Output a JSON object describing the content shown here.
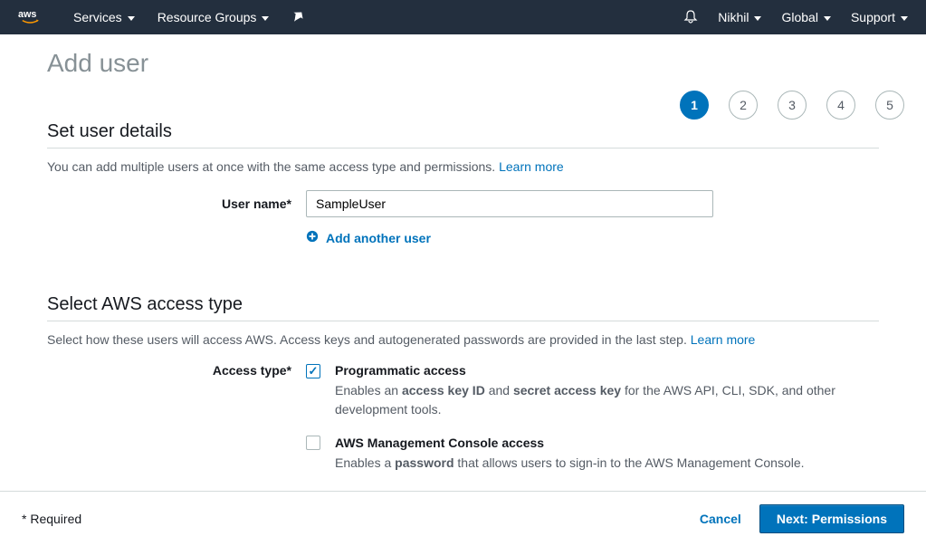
{
  "topbar": {
    "logo": "aws",
    "services": "Services",
    "resource_groups": "Resource Groups",
    "user": "Nikhil",
    "region": "Global",
    "support": "Support"
  },
  "page": {
    "title": "Add user"
  },
  "steps": {
    "s1": "1",
    "s2": "2",
    "s3": "3",
    "s4": "4",
    "s5": "5"
  },
  "section_details": {
    "title": "Set user details",
    "desc": "You can add multiple users at once with the same access type and permissions. ",
    "learn_more": "Learn more",
    "username_label": "User name*",
    "username_value": "SampleUser",
    "add_another": "Add another user"
  },
  "section_access": {
    "title": "Select AWS access type",
    "desc": "Select how these users will access AWS. Access keys and autogenerated passwords are provided in the last step. ",
    "learn_more": "Learn more",
    "access_type_label": "Access type*",
    "option1": {
      "title": "Programmatic access",
      "desc_pre": "Enables an ",
      "desc_b1": "access key ID",
      "desc_mid": " and ",
      "desc_b2": "secret access key",
      "desc_post": " for the AWS API, CLI, SDK, and other development tools."
    },
    "option2": {
      "title": "AWS Management Console access",
      "desc_pre": "Enables a ",
      "desc_b1": "password",
      "desc_post": " that allows users to sign-in to the AWS Management Console."
    }
  },
  "footer": {
    "required": "* Required",
    "cancel": "Cancel",
    "next": "Next: Permissions"
  }
}
